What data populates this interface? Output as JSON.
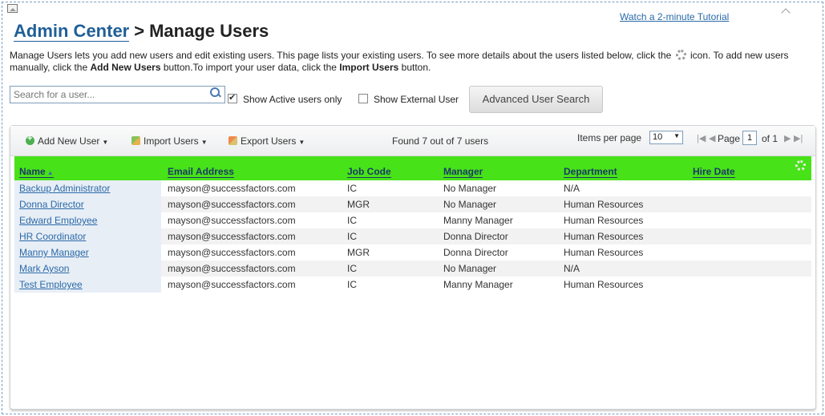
{
  "header": {
    "tutorial_link": "Watch a 2-minute Tutorial",
    "breadcrumb_link": "Admin Center",
    "separator": ">",
    "title": "Manage Users"
  },
  "description": {
    "part1": "Manage Users lets you add new users and edit existing users. This page lists your existing users. To see more details about the users listed below, click the ",
    "part2": " icon. To add new users manually, click the ",
    "bold1": "Add New Users",
    "part3": " button.To import your user data, click the ",
    "bold2": "Import Users",
    "part4": " button."
  },
  "search": {
    "placeholder": "Search for a user...",
    "active_only_label": "Show Active users only",
    "active_only_checked": true,
    "external_label": "Show External User",
    "external_checked": false,
    "advanced_button": "Advanced User Search"
  },
  "toolbar": {
    "add_label": "Add New User",
    "import_label": "Import Users",
    "export_label": "Export Users",
    "found_text": "Found 7 out of 7 users",
    "items_per_page_label": "Items per page",
    "items_per_page_value": "10",
    "page_label": "Page",
    "page_value": "1",
    "page_of": "of 1"
  },
  "table": {
    "columns": [
      "Name",
      "Email Address",
      "Job Code",
      "Manager",
      "Department",
      "Hire Date"
    ],
    "rows": [
      {
        "name": "Backup Administrator",
        "email": "mayson@successfactors.com",
        "job": "IC",
        "manager": "No Manager",
        "dept": "N/A",
        "hire": ""
      },
      {
        "name": "Donna Director",
        "email": "mayson@successfactors.com",
        "job": "MGR",
        "manager": "No Manager",
        "dept": "Human Resources",
        "hire": ""
      },
      {
        "name": "Edward Employee",
        "email": "mayson@successfactors.com",
        "job": "IC",
        "manager": "Manny Manager",
        "dept": "Human Resources",
        "hire": ""
      },
      {
        "name": "HR Coordinator",
        "email": "mayson@successfactors.com",
        "job": "IC",
        "manager": "Donna Director",
        "dept": "Human Resources",
        "hire": ""
      },
      {
        "name": "Manny Manager",
        "email": "mayson@successfactors.com",
        "job": "MGR",
        "manager": "Donna Director",
        "dept": "Human Resources",
        "hire": ""
      },
      {
        "name": "Mark Ayson",
        "email": "mayson@successfactors.com",
        "job": "IC",
        "manager": "No Manager",
        "dept": "N/A",
        "hire": ""
      },
      {
        "name": "Test Employee",
        "email": "mayson@successfactors.com",
        "job": "IC",
        "manager": "Manny Manager",
        "dept": "Human Resources",
        "hire": ""
      }
    ]
  },
  "colors": {
    "header_green": "#47e218",
    "link_blue": "#2a6aa8"
  }
}
